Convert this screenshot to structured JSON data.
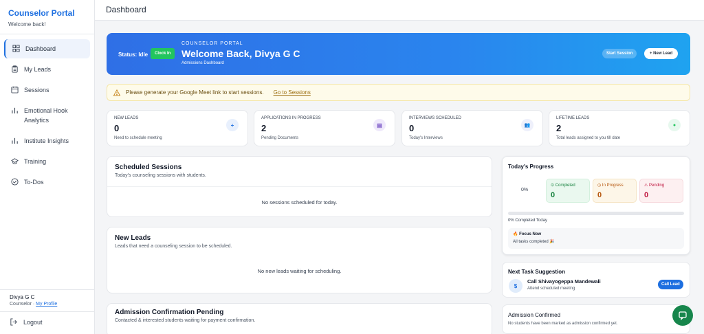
{
  "sidebar": {
    "title": "Counselor Portal",
    "subtitle": "Welcome back!",
    "items": [
      {
        "label": "Dashboard",
        "icon": "grid-icon"
      },
      {
        "label": "My Leads",
        "icon": "clipboard-icon"
      },
      {
        "label": "Sessions",
        "icon": "calendar-icon"
      },
      {
        "label": "Emotional Hook\nAnalytics",
        "icon": "bar-chart-icon"
      },
      {
        "label": "Institute Insights",
        "icon": "bar-chart-icon"
      },
      {
        "label": "Training",
        "icon": "graduation-cap-icon"
      },
      {
        "label": "To-Dos",
        "icon": "check-circle-icon"
      }
    ],
    "user_name": "Divya G C",
    "user_role": "Counselor ·",
    "profile_link": "My Profile",
    "logout": "Logout"
  },
  "header": {
    "title": "Dashboard"
  },
  "hero": {
    "status": "Status: Idle",
    "clock_in": "Clock In",
    "kicker": "COUNSELOR PORTAL",
    "title": "Welcome Back, Divya G C",
    "subtitle": "Admissions Dashboard",
    "start_session": "Start Session",
    "new_lead": "+ New Lead"
  },
  "notice": {
    "text": "Please generate your Google Meet link to start sessions.",
    "link": "Go to Sessions"
  },
  "stats": [
    {
      "label": "NEW LEADS",
      "value": "0",
      "note": "Need to schedule meeting",
      "icon_glyph": "+"
    },
    {
      "label": "APPLICATIONS IN PROGRESS",
      "value": "2",
      "note": "Pending Documents",
      "icon_glyph": "▤"
    },
    {
      "label": "INTERVIEWS SCHEDULED",
      "value": "0",
      "note": "Today's Interviews",
      "icon_glyph": "👥"
    },
    {
      "label": "LIFETIME LEADS",
      "value": "2",
      "note": "Total leads assigned to you till date",
      "icon_glyph": "●"
    }
  ],
  "scheduled": {
    "title": "Scheduled Sessions",
    "subtitle": "Today's counseling sessions with students.",
    "empty": "No sessions scheduled for today."
  },
  "new_leads": {
    "title": "New Leads",
    "subtitle": "Leads that need a counseling session to be scheduled.",
    "empty": "No new leads waiting for scheduling."
  },
  "admission_pending": {
    "title": "Admission Confirmation Pending",
    "subtitle": "Contacted & interested students waiting for payment confirmation."
  },
  "progress": {
    "title": "Today's Progress",
    "ring_value": "0%",
    "completed_label": "Completed",
    "completed": "0",
    "in_progress_label": "In Progress",
    "in_progress": "0",
    "pending_label": "Pending",
    "pending": "0",
    "completed_today": "0% Completed Today",
    "completed_fraction": 0,
    "focus_title": "Focus Now",
    "focus_text": "All tasks completed 🎉"
  },
  "task": {
    "title": "Next Task Suggestion",
    "avatar": "$",
    "name": "Call Shivayogeppa Mandewali",
    "detail": "Attend scheduled meeting",
    "button": "Call Lead"
  },
  "confirmed": {
    "title": "Admission Confirmed",
    "text": "No students have been marked as admission confirmed yet."
  },
  "colors": {
    "accent": "#1d6fe0",
    "success": "#22c55e",
    "chat": "#17864c"
  }
}
